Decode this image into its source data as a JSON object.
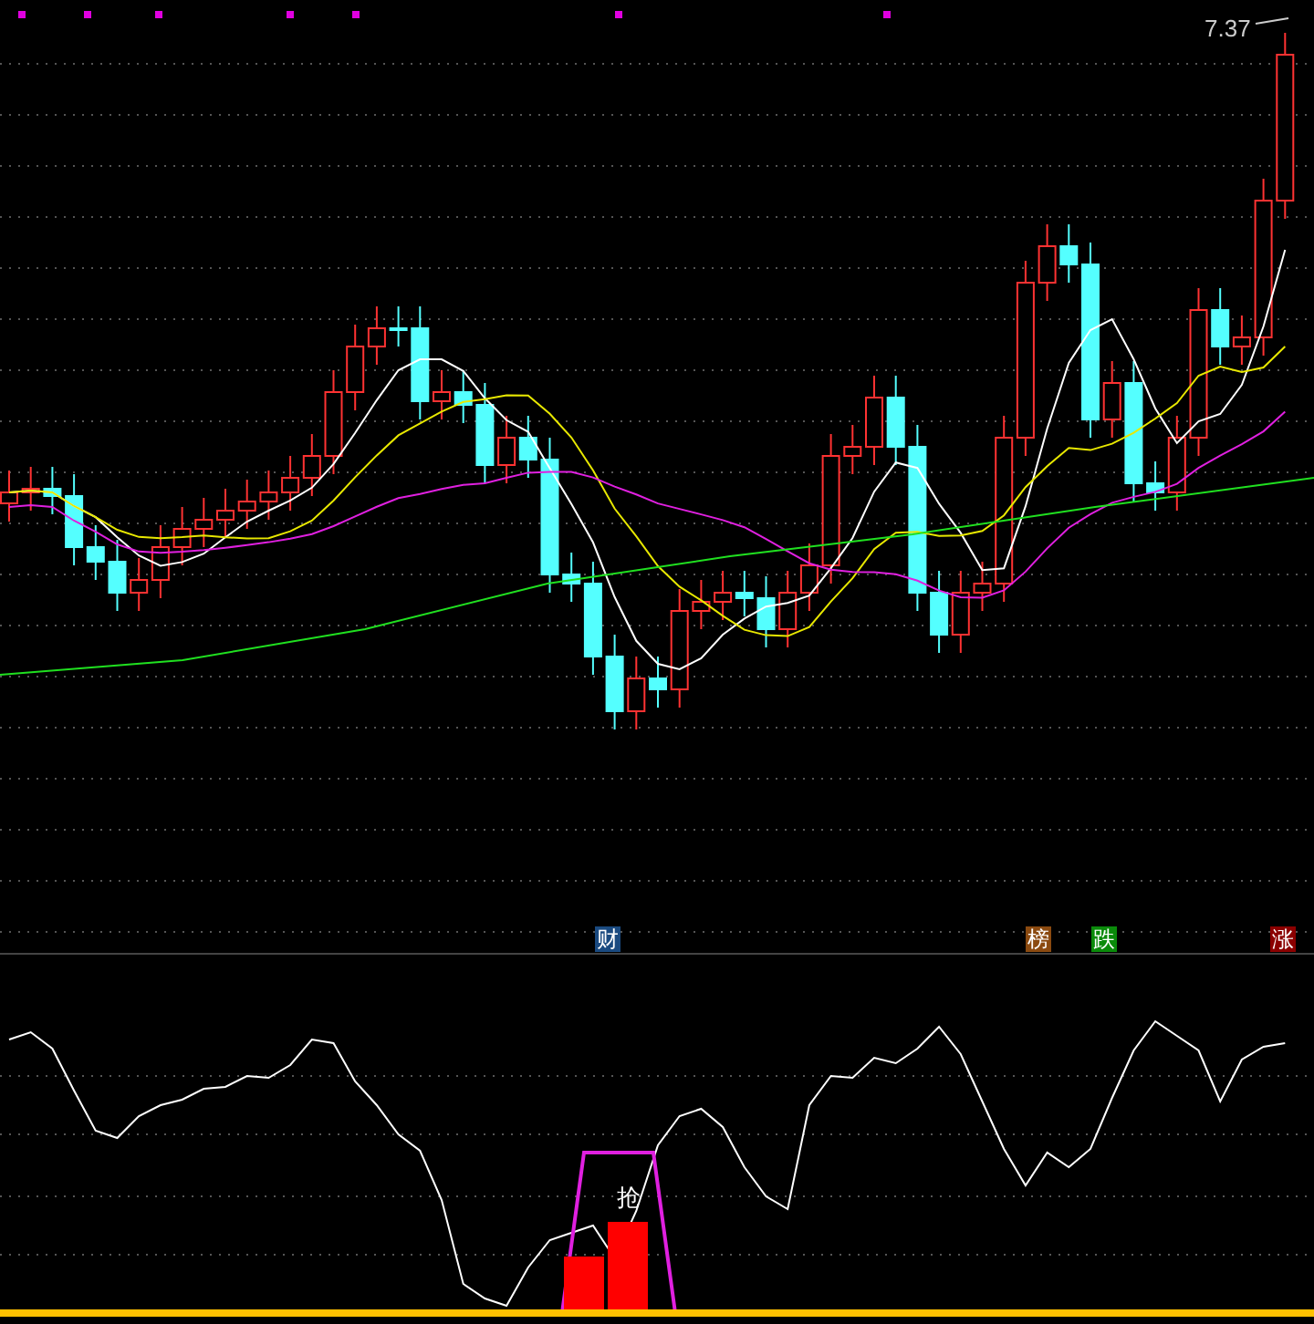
{
  "price_label": "7.37",
  "signals": [
    {
      "label": "财",
      "color": "#1a4a80"
    },
    {
      "label": "榜",
      "color": "#8b4a10"
    },
    {
      "label": "跌",
      "color": "#0a8a0a"
    },
    {
      "label": "涨",
      "color": "#8b0000"
    }
  ],
  "indicator": {
    "marker": "抢"
  }
}
